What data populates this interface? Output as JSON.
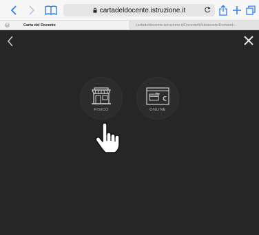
{
  "browser": {
    "url": "cartadeldocente.istruzione.it",
    "icons": [
      "back-icon",
      "forward-icon",
      "bookmarks-icon",
      "lock-icon",
      "reload-icon",
      "share-icon",
      "new-tab-icon",
      "tabs-icon"
    ]
  },
  "tabs": [
    {
      "title": "Carta del Docente",
      "active": true
    },
    {
      "title": "cartadeldocente.istruzione.it/DocenteWeb/assets/Domand...",
      "active": false
    }
  ],
  "page": {
    "options": [
      {
        "label": "FISICO",
        "icon": "shop-icon"
      },
      {
        "label": "ONLINE",
        "icon": "card-euro-icon"
      }
    ],
    "colors": {
      "background": "#262626",
      "icon": "#cfcfcf",
      "label": "#bdbdbd"
    }
  }
}
